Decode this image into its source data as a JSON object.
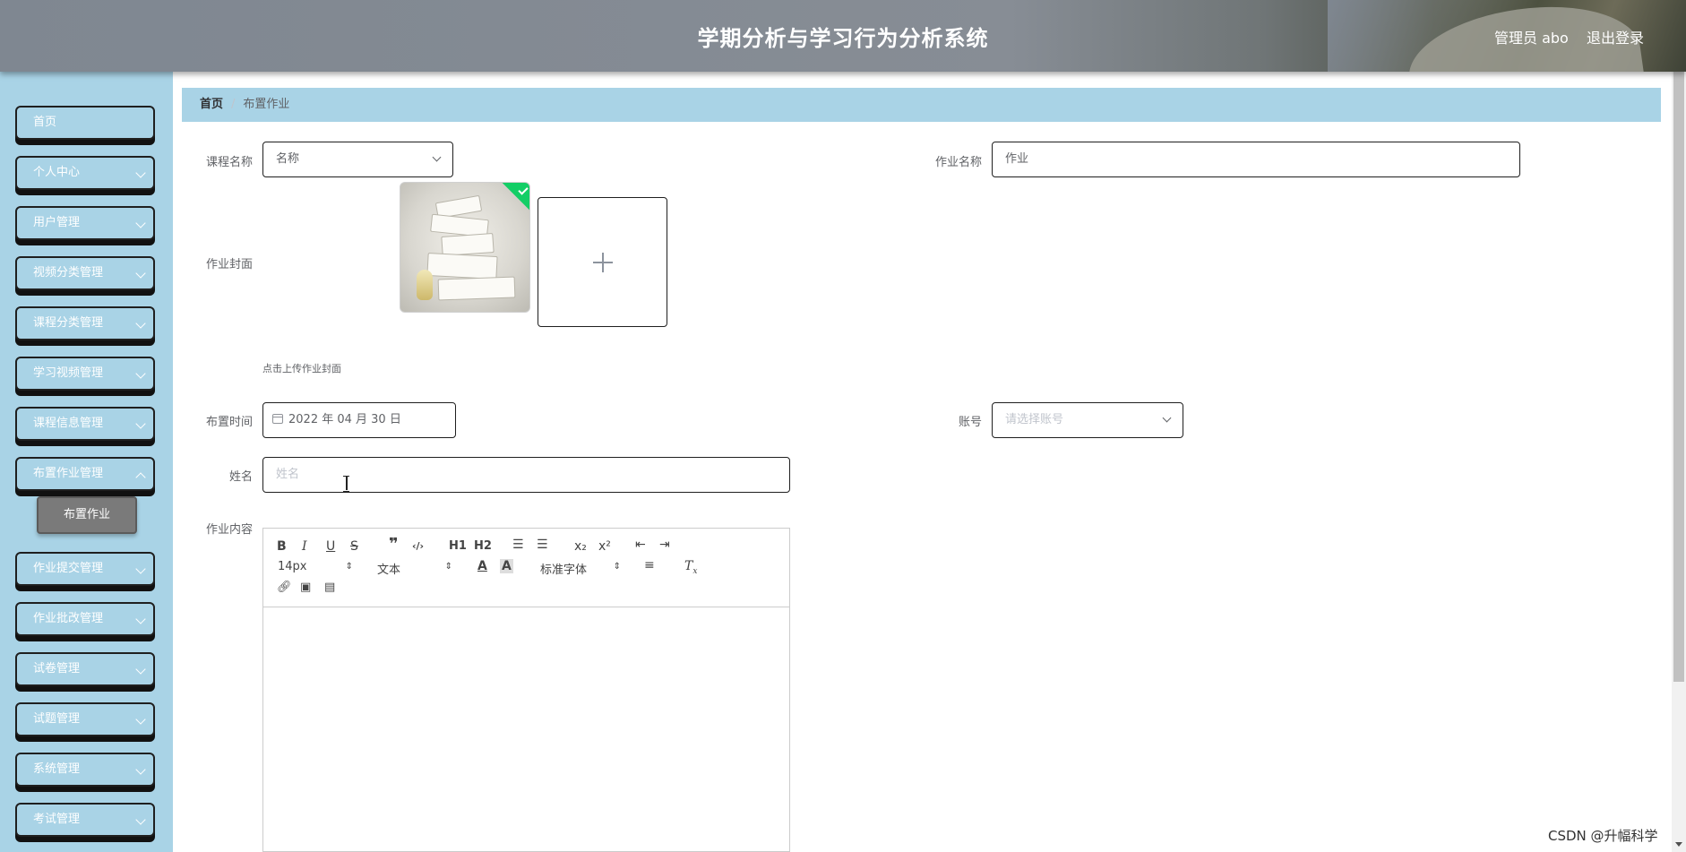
{
  "header": {
    "title": "学期分析与学习行为分析系统",
    "admin": "管理员 abo",
    "logout": "退出登录"
  },
  "sidebar": {
    "items": [
      {
        "label": "首页"
      },
      {
        "label": "个人中心"
      },
      {
        "label": "用户管理"
      },
      {
        "label": "视频分类管理"
      },
      {
        "label": "课程分类管理"
      },
      {
        "label": "学习视频管理"
      },
      {
        "label": "课程信息管理"
      },
      {
        "label": "布置作业管理"
      },
      {
        "label": "作业提交管理"
      },
      {
        "label": "作业批改管理"
      },
      {
        "label": "试卷管理"
      },
      {
        "label": "试题管理"
      },
      {
        "label": "系统管理"
      },
      {
        "label": "考试管理"
      }
    ],
    "active_sub": "布置作业"
  },
  "breadcrumb": {
    "home": "首页",
    "current": "布置作业"
  },
  "form": {
    "course_label": "课程名称",
    "course_value": "名称",
    "homework_name_label": "作业名称",
    "homework_name_value": "作业",
    "cover_label": "作业封面",
    "cover_hint": "点击上传作业封面",
    "time_label": "布置时间",
    "time_value": "2022 年 04 月 30 日",
    "account_label": "账号",
    "account_placeholder": "请选择账号",
    "name_label": "姓名",
    "name_placeholder": "姓名",
    "content_label": "作业内容"
  },
  "editor": {
    "font_size": "14px",
    "format": "文本",
    "font_family": "标准字体",
    "buttons": [
      "B",
      "I",
      "U",
      "S",
      "❞",
      "‹/›",
      "H1",
      "H2",
      "ordered-list",
      "bullet-list",
      "x₂",
      "x²",
      "outdent",
      "indent"
    ]
  },
  "watermark": "CSDN @升幅科学"
}
